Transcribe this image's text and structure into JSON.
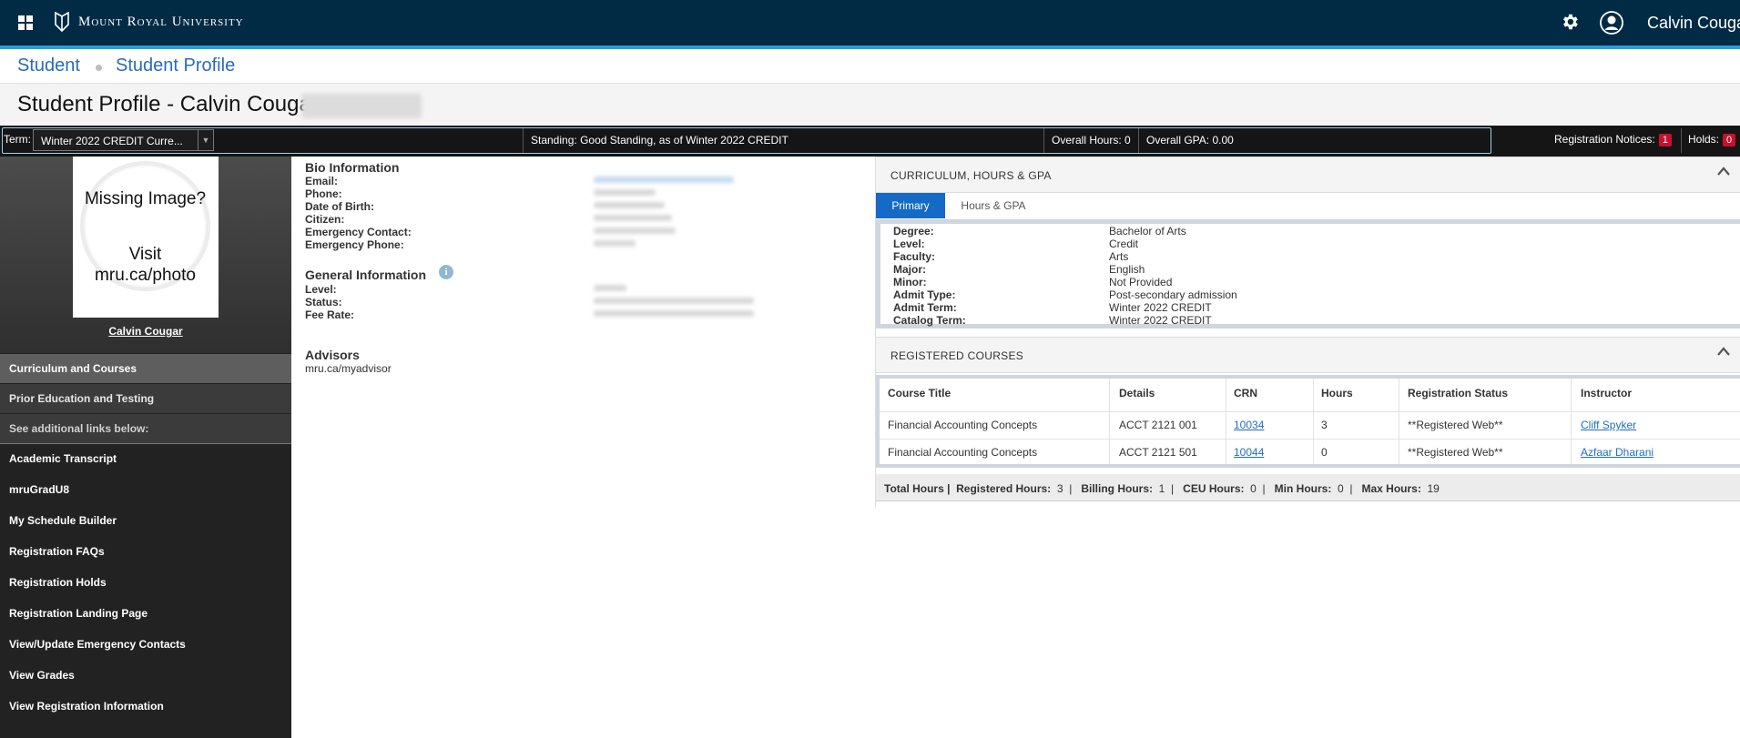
{
  "header": {
    "logo_text": "Mount Royal University",
    "user_name": "Calvin Cougar",
    "icons": [
      "apps-grid-icon",
      "gear-icon",
      "user-icon"
    ]
  },
  "breadcrumb": {
    "items": [
      "Student",
      "Student Profile"
    ]
  },
  "page": {
    "title": "Student Profile - Calvin Cougar"
  },
  "termbar": {
    "term_label": "Term:",
    "term_value": "Winter 2022 CREDIT Curre...",
    "standing_label": "Standing:",
    "standing_value": "Good Standing, as of Winter 2022 CREDIT",
    "overall_hours": "Overall Hours: 0",
    "overall_gpa": "Overall GPA: 0.00",
    "registration_notices_label": "Registration Notices:",
    "registration_notices_count": "1",
    "holds_label": "Holds:",
    "holds_count": "0"
  },
  "sidebar": {
    "photo_text_1": "Missing Image?",
    "photo_text_2": "Visit mru.ca/photo",
    "student_name": "Calvin Cougar",
    "sections": [
      "Curriculum and Courses",
      "Prior Education and Testing",
      "See additional links below:"
    ],
    "links": [
      "Academic Transcript",
      "mruGradU8",
      "My Schedule Builder",
      "Registration FAQs",
      "Registration Holds",
      "Registration Landing Page",
      "View/Update Emergency Contacts",
      "View Grades",
      "View Registration Information"
    ]
  },
  "bio": {
    "heading": "Bio Information",
    "labels": [
      "Email:",
      "Phone:",
      "Date of Birth:",
      "Citizen:",
      "Emergency Contact:",
      "Emergency Phone:"
    ]
  },
  "general": {
    "heading": "General Information",
    "labels": [
      "Level:",
      "Status:",
      "Fee Rate:"
    ]
  },
  "advisors": {
    "heading": "Advisors",
    "value": "mru.ca/myadvisor"
  },
  "curriculum": {
    "heading": "CURRICULUM, HOURS & GPA",
    "tabs": [
      "Primary",
      "Hours & GPA"
    ],
    "rows": [
      {
        "label": "Degree:",
        "value": "Bachelor of Arts"
      },
      {
        "label": "Level:",
        "value": "Credit"
      },
      {
        "label": "Faculty:",
        "value": "Arts"
      },
      {
        "label": "Major:",
        "value": "English"
      },
      {
        "label": "Minor:",
        "value": "Not Provided"
      },
      {
        "label": "Admit Type:",
        "value": "Post-secondary admission"
      },
      {
        "label": "Admit Term:",
        "value": "Winter 2022 CREDIT"
      },
      {
        "label": "Catalog Term:",
        "value": "Winter 2022 CREDIT"
      }
    ]
  },
  "courses": {
    "heading": "REGISTERED COURSES",
    "columns": [
      "Course Title",
      "Details",
      "CRN",
      "Hours",
      "Registration Status",
      "Instructor"
    ],
    "rows": [
      {
        "title": "Financial Accounting Concepts",
        "details": "ACCT 2121 001",
        "crn": "10034",
        "hours": "3",
        "status": "**Registered Web**",
        "instructor": "Cliff Spyker"
      },
      {
        "title": "Financial Accounting Concepts",
        "details": "ACCT 2121 501",
        "crn": "10044",
        "hours": "0",
        "status": "**Registered Web**",
        "instructor": "Azfaar Dharani"
      }
    ],
    "totals": {
      "total_label": "Total Hours |",
      "registered_label": "Registered Hours:",
      "registered": "3",
      "billing_label": "Billing Hours:",
      "billing": "1",
      "ceu_label": "CEU Hours:",
      "ceu": "0",
      "min_label": "Min Hours:",
      "min": "0",
      "max_label": "Max Hours:",
      "max": "19"
    }
  },
  "colors": {
    "header_bg": "#012b45",
    "accent_line": "#2a9fd8",
    "link": "#2a6cb5",
    "tab_active": "#1569c7",
    "badge": "#c8102e"
  }
}
